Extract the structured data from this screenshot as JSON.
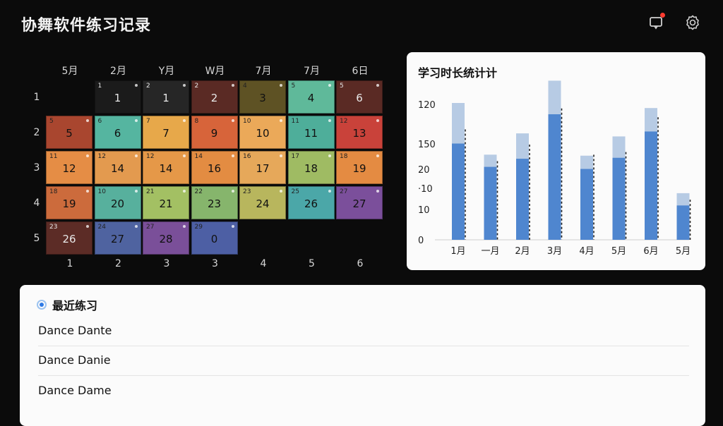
{
  "app": {
    "title": "协舞软件练习记录"
  },
  "icons": {
    "notification": "notification-icon",
    "settings": "gear-icon"
  },
  "calendar": {
    "col_labels": [
      "5月",
      "2月",
      "Y月",
      "W月",
      "7月",
      "7月",
      "6日"
    ],
    "row_labels": [
      "1",
      "2",
      "3",
      "4",
      "5"
    ],
    "bottom_labels": [
      "1",
      "2",
      "3",
      "3",
      "4",
      "5",
      "6"
    ],
    "cells": [
      {
        "r": 0,
        "c": 1,
        "small": "1",
        "big": "1",
        "color": "#1b1b1b",
        "dark": true
      },
      {
        "r": 0,
        "c": 2,
        "small": "2",
        "big": "1",
        "color": "#262626",
        "dark": true
      },
      {
        "r": 0,
        "c": 3,
        "small": "2",
        "big": "2",
        "color": "#5a2a24",
        "dark": true
      },
      {
        "r": 0,
        "c": 4,
        "small": "4",
        "big": "3",
        "color": "#5e5224"
      },
      {
        "r": 0,
        "c": 5,
        "small": "5",
        "big": "4",
        "color": "#5fb99a"
      },
      {
        "r": 0,
        "c": 6,
        "small": "5",
        "big": "6",
        "color": "#5a2a24",
        "dark": true
      },
      {
        "r": 1,
        "c": 0,
        "small": "5",
        "big": "5",
        "color": "#a9462f"
      },
      {
        "r": 1,
        "c": 1,
        "small": "6",
        "big": "6",
        "color": "#55b5a0"
      },
      {
        "r": 1,
        "c": 2,
        "small": "7",
        "big": "7",
        "color": "#e7a84a"
      },
      {
        "r": 1,
        "c": 3,
        "small": "8",
        "big": "9",
        "color": "#d7643a"
      },
      {
        "r": 1,
        "c": 4,
        "small": "10",
        "big": "10",
        "color": "#eba959"
      },
      {
        "r": 1,
        "c": 5,
        "small": "11",
        "big": "11",
        "color": "#4eae9a"
      },
      {
        "r": 1,
        "c": 6,
        "small": "12",
        "big": "13",
        "color": "#c9423a"
      },
      {
        "r": 2,
        "c": 0,
        "small": "11",
        "big": "12",
        "color": "#e58d45"
      },
      {
        "r": 2,
        "c": 1,
        "small": "12",
        "big": "14",
        "color": "#e39a4f"
      },
      {
        "r": 2,
        "c": 2,
        "small": "12",
        "big": "14",
        "color": "#e59848"
      },
      {
        "r": 2,
        "c": 3,
        "small": "14",
        "big": "16",
        "color": "#e38c42"
      },
      {
        "r": 2,
        "c": 4,
        "small": "16",
        "big": "17",
        "color": "#e6a85a"
      },
      {
        "r": 2,
        "c": 5,
        "small": "17",
        "big": "18",
        "color": "#9fbb63"
      },
      {
        "r": 2,
        "c": 6,
        "small": "18",
        "big": "19",
        "color": "#e48b42"
      },
      {
        "r": 3,
        "c": 0,
        "small": "18",
        "big": "19",
        "color": "#cc6b3c"
      },
      {
        "r": 3,
        "c": 1,
        "small": "10",
        "big": "20",
        "color": "#57b09d"
      },
      {
        "r": 3,
        "c": 2,
        "small": "21",
        "big": "21",
        "color": "#a3c063"
      },
      {
        "r": 3,
        "c": 3,
        "small": "22",
        "big": "23",
        "color": "#86b56c"
      },
      {
        "r": 3,
        "c": 4,
        "small": "23",
        "big": "24",
        "color": "#b8b65d"
      },
      {
        "r": 3,
        "c": 5,
        "small": "25",
        "big": "26",
        "color": "#4ba7a8"
      },
      {
        "r": 3,
        "c": 6,
        "small": "27",
        "big": "27",
        "color": "#7b4f9b"
      },
      {
        "r": 4,
        "c": 0,
        "small": "23",
        "big": "26",
        "color": "#5c2c26",
        "dark": true
      },
      {
        "r": 4,
        "c": 1,
        "small": "24",
        "big": "27",
        "color": "#4f63a0"
      },
      {
        "r": 4,
        "c": 2,
        "small": "27",
        "big": "28",
        "color": "#7a4f99"
      },
      {
        "r": 4,
        "c": 3,
        "small": "29",
        "big": "0",
        "color": "#4d5fa4"
      }
    ]
  },
  "chart_card": {
    "title": "学习时长统计计"
  },
  "chart_data": {
    "type": "bar",
    "title": "学习时长统计计",
    "categories": [
      "1月",
      "一月",
      "2月",
      "3月",
      "4月",
      "5月",
      "6月",
      "5月"
    ],
    "y_tick_labels": [
      "0",
      "10",
      "·10",
      "20",
      "150",
      "120"
    ],
    "series": [
      {
        "values": [
          95,
          72,
          80,
          124,
          70,
          81,
          107,
          34
        ]
      },
      {
        "values": [
          40,
          12,
          25,
          33,
          13,
          21,
          23,
          12
        ]
      }
    ],
    "colors": [
      "#4f86cf",
      "#b7cbe4"
    ],
    "ylim": [
      0,
      135
    ],
    "stacked": true,
    "grid": false,
    "legend": "none"
  },
  "recent": {
    "header": "最近练习",
    "items": [
      "Dance Dante",
      "Dance Danie",
      "Dance Dame"
    ]
  }
}
